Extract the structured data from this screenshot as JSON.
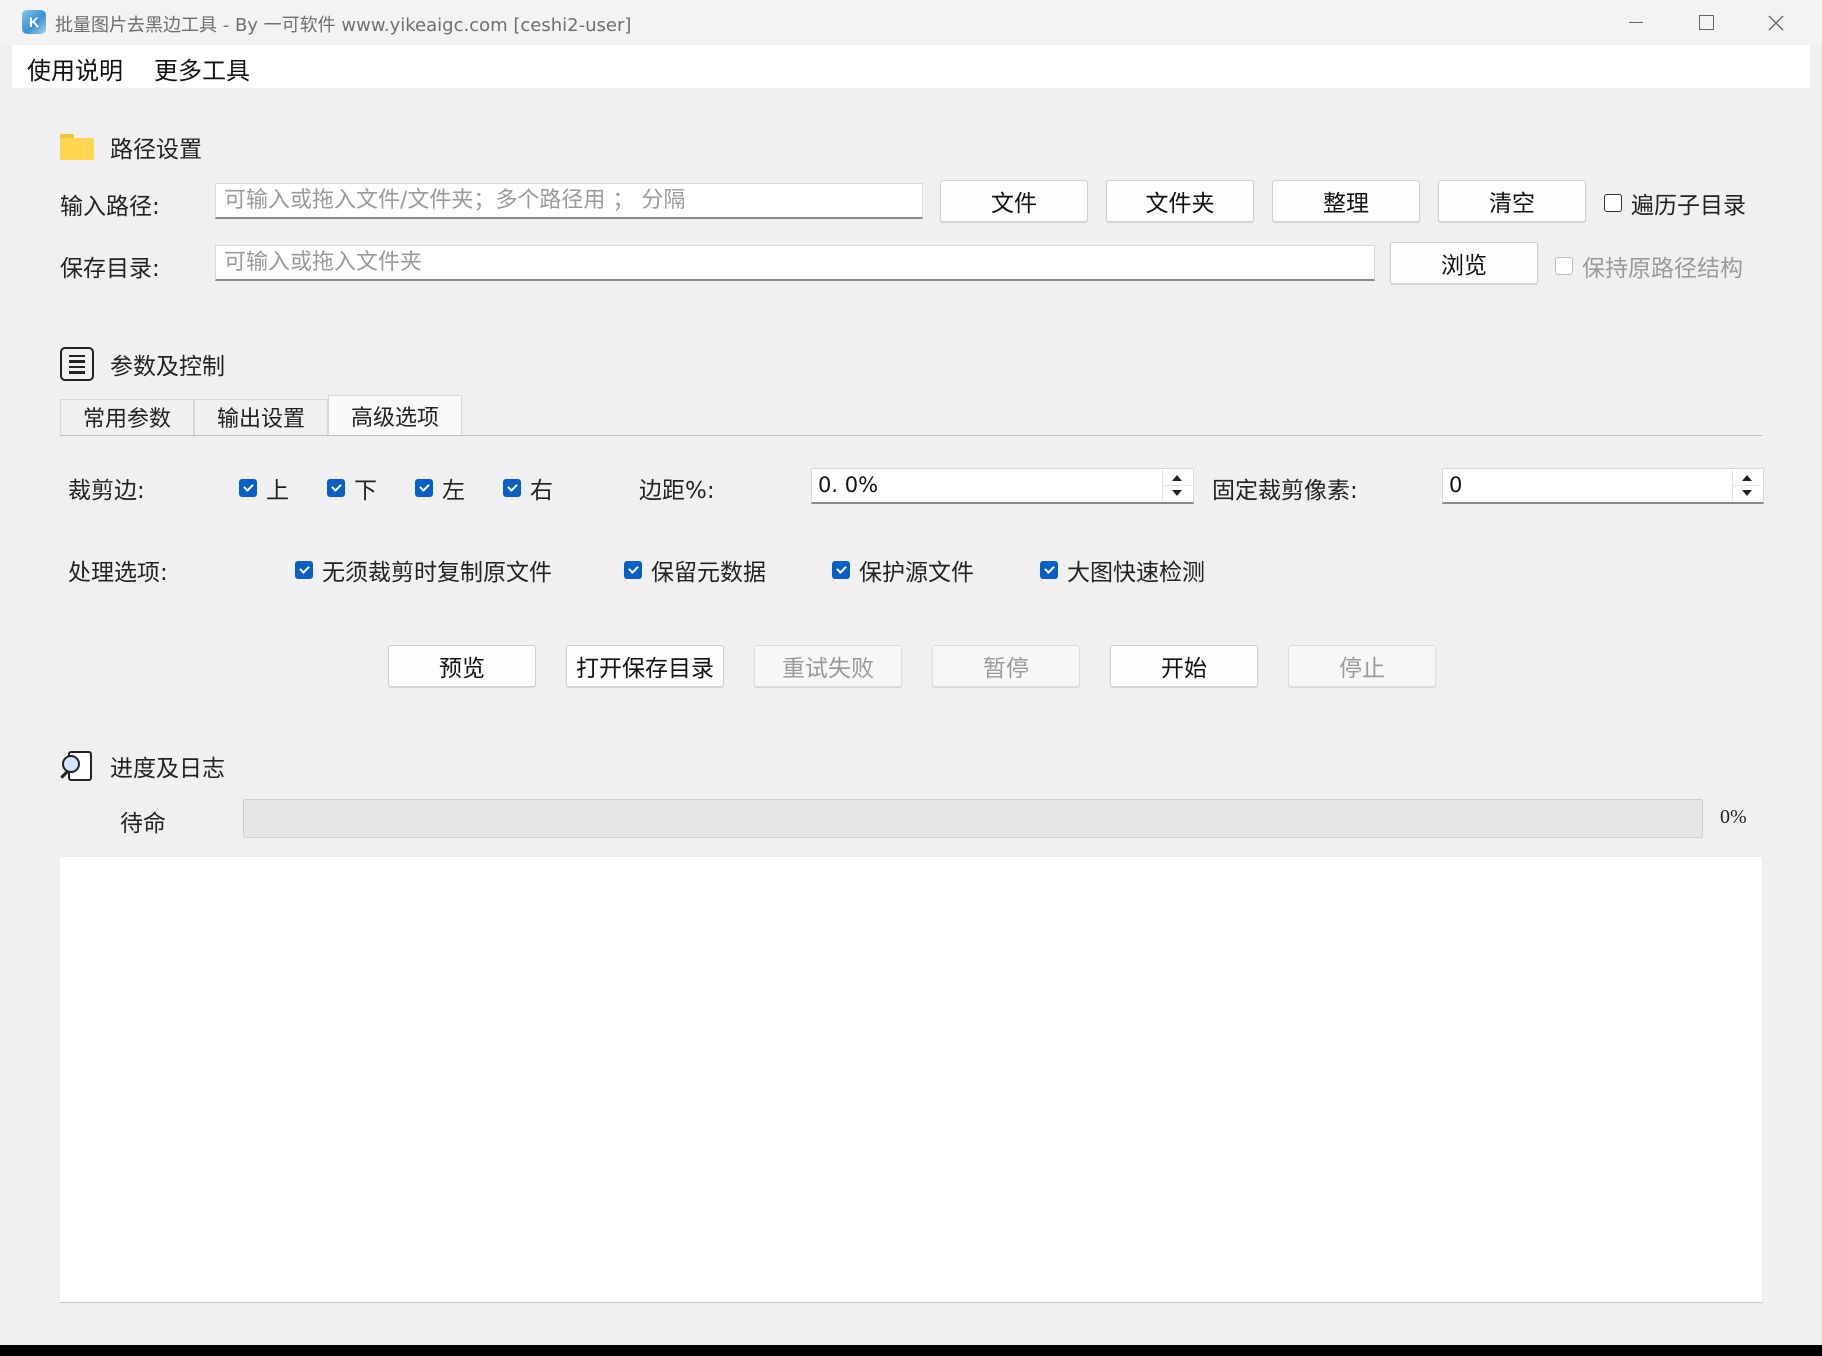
{
  "window": {
    "title": "批量图片去黑边工具 - By 一可软件 www.yikeaigc.com  [ceshi2-user]",
    "app_icon_glyph": "K"
  },
  "menu": {
    "items": [
      "使用说明",
      "更多工具"
    ]
  },
  "path_section": {
    "title": "路径设置",
    "icon": "folder-icon",
    "input_label": "输入路径:",
    "input_value": "",
    "input_placeholder": "可输入或拖入文件/文件夹；多个路径用 ； 分隔",
    "file_btn": "文件",
    "folder_btn": "文件夹",
    "organize_btn": "整理",
    "clear_btn": "清空",
    "recurse_label": "遍历子目录",
    "recurse_checked": false,
    "save_label": "保存目录:",
    "save_value": "",
    "save_placeholder": "可输入或拖入文件夹",
    "browse_btn": "浏览",
    "keep_structure_label": "保持原路径结构",
    "keep_structure_checked": false,
    "keep_structure_enabled": false
  },
  "params_section": {
    "title": "参数及控制",
    "icon": "document-list-icon",
    "tabs": [
      {
        "label": "常用参数",
        "active": false
      },
      {
        "label": "输出设置",
        "active": false
      },
      {
        "label": "高级选项",
        "active": true
      }
    ],
    "crop_label": "裁剪边:",
    "crop_edges": [
      {
        "label": "上",
        "checked": true
      },
      {
        "label": "下",
        "checked": true
      },
      {
        "label": "左",
        "checked": true
      },
      {
        "label": "右",
        "checked": true
      }
    ],
    "margin_label": "边距%:",
    "margin_value": "0. 0%",
    "fixed_label": "固定裁剪像素:",
    "fixed_value": "0",
    "options_label": "处理选项:",
    "options": [
      {
        "label": "无须裁剪时复制原文件",
        "checked": true
      },
      {
        "label": "保留元数据",
        "checked": true
      },
      {
        "label": "保护源文件",
        "checked": true
      },
      {
        "label": "大图快速检测",
        "checked": true
      }
    ]
  },
  "actions": {
    "preview": "预览",
    "open_save": "打开保存目录",
    "retry": "重试失败",
    "pause": "暂停",
    "start": "开始",
    "stop": "停止"
  },
  "progress_section": {
    "title": "进度及日志",
    "icon": "log-search-icon",
    "status": "待命",
    "percent_text": "0%",
    "percent": 0,
    "log_text": ""
  },
  "colors": {
    "accent": "#0a5fc4",
    "window_bg": "#f0f0f0",
    "folder": "#ffd54f"
  }
}
